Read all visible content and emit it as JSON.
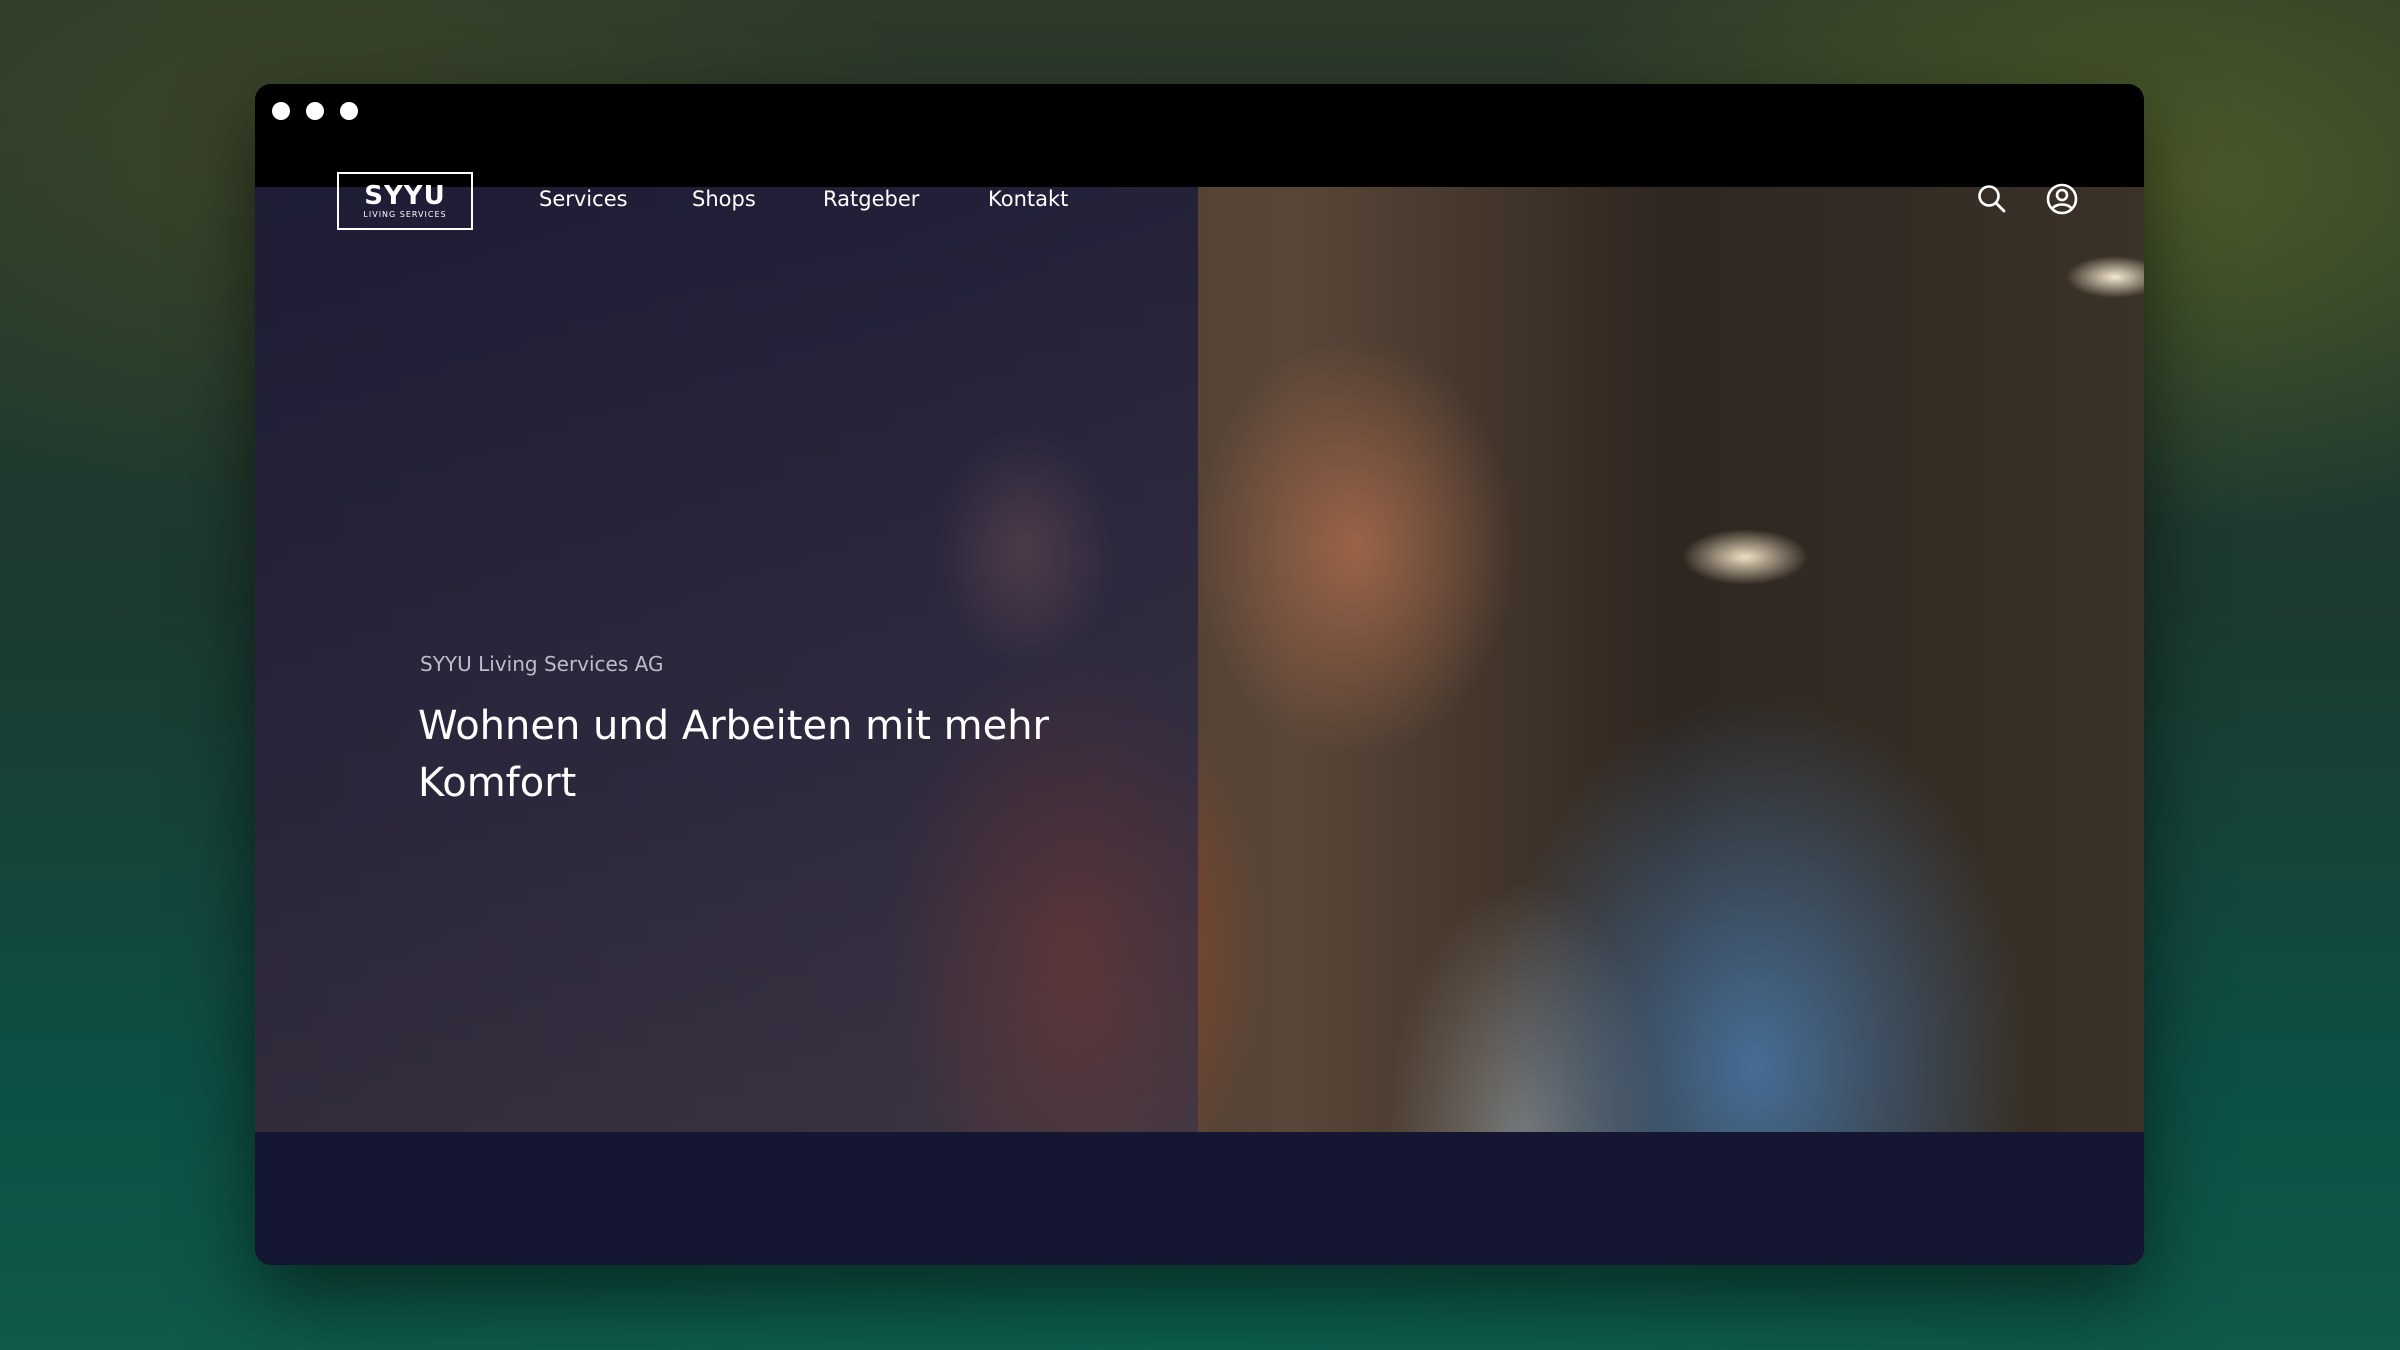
{
  "window": {
    "controls": [
      "dot",
      "dot",
      "dot"
    ]
  },
  "brand": {
    "logo_text": "SYYU",
    "logo_subtext": "LIVING SERVICES"
  },
  "nav": {
    "items": [
      {
        "label": "Services"
      },
      {
        "label": "Shops"
      },
      {
        "label": "Ratgeber"
      },
      {
        "label": "Kontakt"
      }
    ],
    "icons": [
      "search-icon",
      "user-account-icon"
    ]
  },
  "hero": {
    "eyebrow": "SYYU Living Services AG",
    "headline": "Wohnen und Arbeiten mit mehr Komfort"
  },
  "colors": {
    "nav_text": "#ffffff",
    "dark_navy": "#141632",
    "overlay": "#16183a"
  }
}
